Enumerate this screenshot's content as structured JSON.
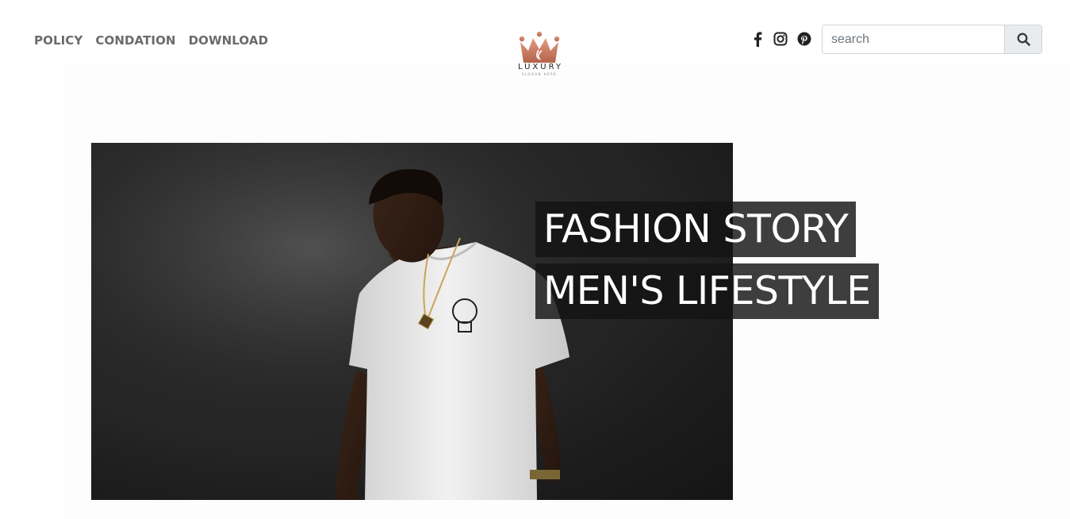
{
  "nav": {
    "items": [
      {
        "label": "POLICY"
      },
      {
        "label": "CONDATION"
      },
      {
        "label": "DOWNLOAD"
      }
    ]
  },
  "logo": {
    "text": "LUXURY",
    "tagline": "SLOGAN HERE",
    "color": "#c8765f"
  },
  "social": [
    "facebook-icon",
    "instagram-icon",
    "pinterest-icon"
  ],
  "search": {
    "placeholder": "search",
    "value": ""
  },
  "hero": {
    "line1": "FASHION STORY",
    "line2": "MEN'S LIFESTYLE"
  }
}
